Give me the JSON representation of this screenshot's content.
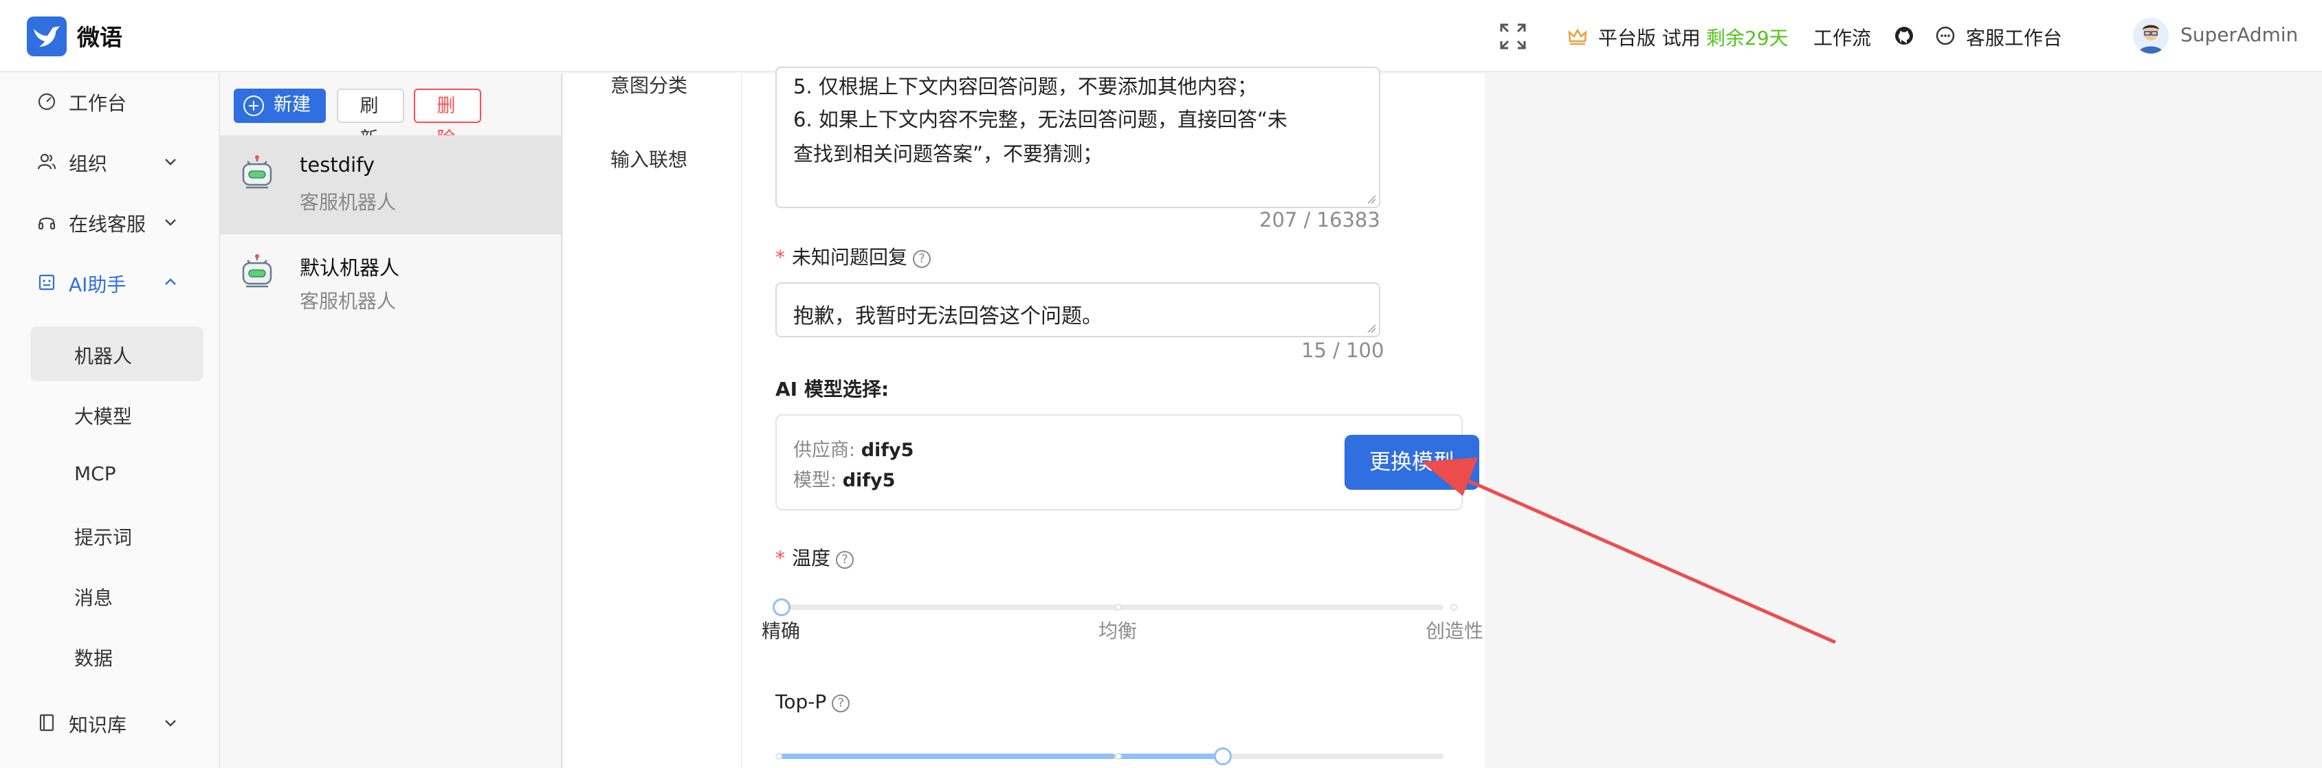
{
  "header": {
    "app_title": "微语",
    "plan_text": "平台版 试用",
    "plan_remaining": "剩余29天",
    "workflow_label": "工作流",
    "service_label": "客服工作台",
    "username": "SuperAdmin",
    "icons": [
      "logo-bird-icon",
      "fullscreen-icon",
      "crown-icon",
      "github-icon",
      "chat-icon"
    ]
  },
  "sidebar": {
    "items": [
      {
        "label": "工作台",
        "icon": "dashboard-icon"
      },
      {
        "label": "组织",
        "icon": "users-icon"
      },
      {
        "label": "在线客服",
        "icon": "headset-icon"
      },
      {
        "label": "AI助手",
        "icon": "robot-icon"
      },
      {
        "label": "知识库",
        "icon": "book-icon"
      }
    ],
    "ai_subitems": [
      "机器人",
      "大模型",
      "MCP",
      "提示词",
      "消息",
      "数据"
    ],
    "active_color": "#2f6fdf"
  },
  "robot_list": {
    "new_label": "新建",
    "refresh_label": "刷 新",
    "delete_label": "删 除",
    "robots": [
      {
        "name": "testdify",
        "desc": "客服机器人"
      },
      {
        "name": "默认机器人",
        "desc": "客服机器人"
      }
    ]
  },
  "section_tabs": [
    "意图分类",
    "输入联想"
  ],
  "form": {
    "prompt_lines": [
      "5. 仅根据上下文内容回答问题，不要添加其他内容；",
      "6. 如果上下文内容不完整，无法回答问题，直接回答“未",
      "查找到相关问题答案”，不要猜测；"
    ],
    "prompt_counter": "207 / 16383",
    "unknown_label": "未知问题回复",
    "unknown_value": "抱歉，我暂时无法回答这个问题。",
    "unknown_counter": "15 / 100",
    "model_label": "AI 模型选择:",
    "provider_key": "供应商:",
    "provider_value": "dify5",
    "model_key": "模型:",
    "model_value": "dify5",
    "change_model_label": "更换模型",
    "temperature_label": "温度",
    "temperature_marks": [
      "精确",
      "均衡",
      "创造性"
    ],
    "temperature_value": 0,
    "top_p_label": "Top-P",
    "top_p_value": 0.7,
    "help_glyph": "?"
  }
}
